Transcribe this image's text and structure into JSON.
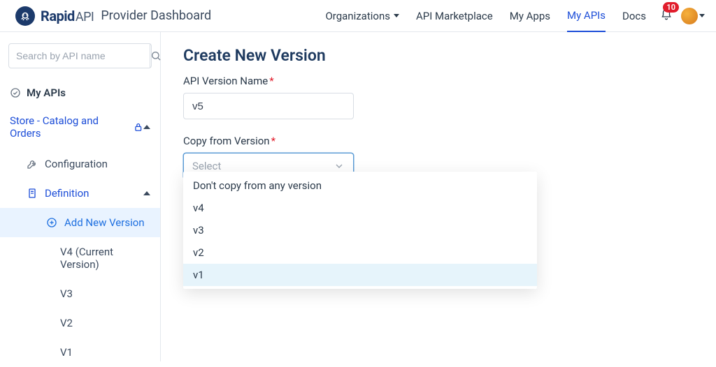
{
  "brand": {
    "name": "Rapid",
    "suffix": "API"
  },
  "header": {
    "title": "Provider Dashboard",
    "nav": {
      "organizations": "Organizations",
      "marketplace": "API Marketplace",
      "my_apps": "My Apps",
      "my_apis": "My APIs",
      "docs": "Docs"
    },
    "notification_count": "10"
  },
  "sidebar": {
    "search_placeholder": "Search by API name",
    "my_apis_label": "My APIs",
    "api_name": "Store - Catalog and Orders",
    "configuration": "Configuration",
    "definition": "Definition",
    "add_new_version": "Add New Version",
    "versions": {
      "v4": "V4 (Current Version)",
      "v3": "V3",
      "v2": "V2",
      "v1": "V1"
    }
  },
  "main": {
    "title": "Create New Version",
    "name_label": "API Version Name",
    "name_value": "v5",
    "copy_label": "Copy from Version",
    "select_placeholder": "Select",
    "dropdown": {
      "none": "Don't copy from any version",
      "v4": "v4",
      "v3": "v3",
      "v2": "v2",
      "v1": "v1"
    }
  }
}
